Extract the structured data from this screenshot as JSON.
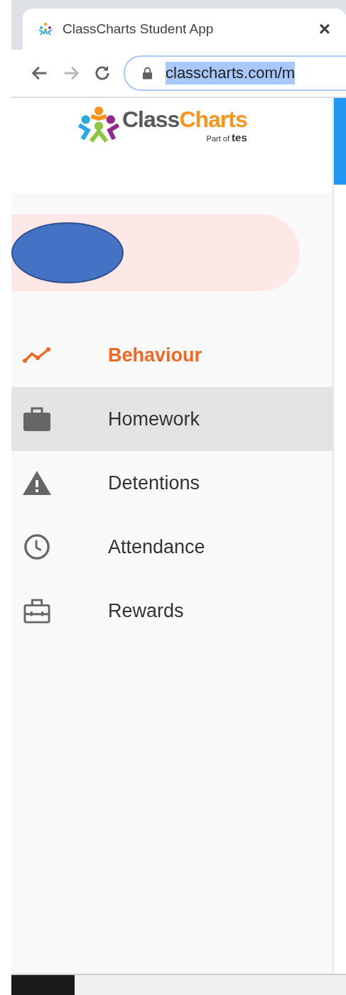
{
  "browser": {
    "tab_title": "ClassCharts Student App",
    "close": "×",
    "url": "classcharts.com/m",
    "url_selected": true
  },
  "logo": {
    "parts": [
      "Class",
      "Charts"
    ],
    "tagline_prefix": "Part of",
    "tagline_brand": "tes"
  },
  "nav": [
    {
      "label": "Behaviour",
      "kind": "chart",
      "selected": true,
      "hovered": false
    },
    {
      "label": "Homework",
      "kind": "briefcase",
      "selected": false,
      "hovered": true
    },
    {
      "label": "Detentions",
      "kind": "warning",
      "selected": false,
      "hovered": false
    },
    {
      "label": "Attendance",
      "kind": "clock",
      "selected": false,
      "hovered": false
    },
    {
      "label": "Rewards",
      "kind": "toolbox",
      "selected": false,
      "hovered": false
    }
  ]
}
